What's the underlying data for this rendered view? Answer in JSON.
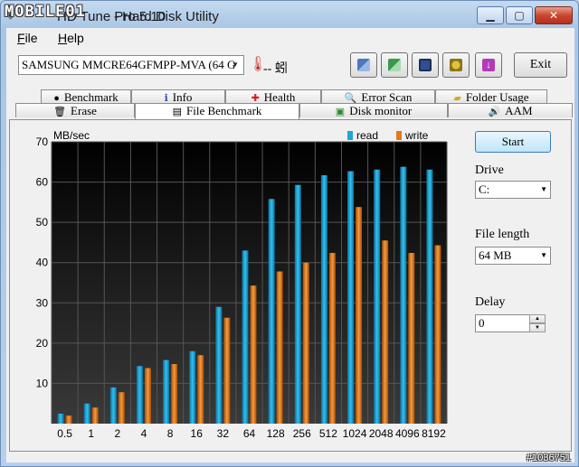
{
  "window": {
    "title_prefix": "HD Tune Pro 5.10",
    "title": "Hard Disk Utility",
    "logo_text": "MOBILE01"
  },
  "menu": [
    {
      "label": "File",
      "acc": "F",
      "rest": "ile"
    },
    {
      "label": "Help",
      "acc": "H",
      "rest": "elp"
    }
  ],
  "toolbar": {
    "drive_value": "SAMSUNG MMCRE64GFMPP-MVA (64 G",
    "temperature_text": "-- 蚓",
    "exit_label": "Exit"
  },
  "tabs": {
    "row1": [
      "Benchmark",
      "Info",
      "Health",
      "Error Scan",
      "Folder Usage"
    ],
    "row2": [
      "Erase",
      "File Benchmark",
      "Disk monitor",
      "AAM"
    ],
    "active": "File Benchmark"
  },
  "controls": {
    "start_label": "Start",
    "drive_label": "Drive",
    "drive_value": "C:",
    "file_length_label": "File length",
    "file_length_value": "64 MB",
    "delay_label": "Delay",
    "delay_value": "0"
  },
  "chart_data": {
    "type": "bar",
    "ylabel": "MB/sec",
    "ylim": [
      0,
      70
    ],
    "yticks": [
      10,
      20,
      30,
      40,
      50,
      60,
      70
    ],
    "categories": [
      "0.5",
      "1",
      "2",
      "4",
      "8",
      "16",
      "32",
      "64",
      "128",
      "256",
      "512",
      "1024",
      "2048",
      "4096",
      "8192"
    ],
    "series": [
      {
        "name": "read",
        "color": "#1fa6d6",
        "values": [
          2.5,
          5.0,
          9.0,
          14.3,
          15.8,
          18.0,
          29.0,
          43.0,
          55.8,
          59.3,
          61.7,
          62.7,
          63.1,
          63.8,
          63.1
        ]
      },
      {
        "name": "write",
        "color": "#e07a1c",
        "values": [
          2.0,
          4.0,
          7.8,
          13.8,
          14.8,
          17.0,
          26.3,
          34.3,
          37.8,
          40.0,
          42.4,
          53.8,
          45.5,
          42.4,
          44.3
        ]
      }
    ],
    "legend": "top-right",
    "grid": true
  },
  "watermark_id": "#1036751"
}
